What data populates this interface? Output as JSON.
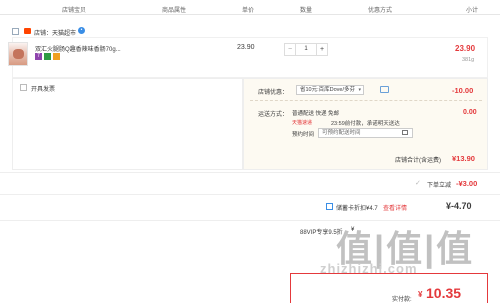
{
  "header": {
    "col_store": "店铺宝贝",
    "col_props": "商品属性",
    "col_price": "单价",
    "col_qty": "数量",
    "col_discount": "优惠方式",
    "col_subtotal": "小计"
  },
  "store": {
    "label": "店铺：天猫超市"
  },
  "item": {
    "title": "双汇火腿肠Q趣香辣味香肠70g...",
    "unit_price": "23.90",
    "qty": "1",
    "subtotal": "23.90",
    "weight": "381g",
    "tags": [
      {
        "name": "7",
        "color": "#8e44ad"
      },
      {
        "name": "绿",
        "color": "#2e9a43"
      },
      {
        "name": "黄",
        "color": "#f0a020"
      }
    ]
  },
  "extras": {
    "invoice_label": "开具发票",
    "coupon_label": "店铺优惠：",
    "coupon_value": "省10元:百库Dove/多芬",
    "coupon_amount": "-10.00",
    "delivery_label": "运送方式：",
    "delivery_mode": "普通配送 快递 免邮",
    "delivery_tag": "天猫速递",
    "delivery_note": "23:59前付款，承诺明天送达",
    "delivery_time_label": "预约时间",
    "delivery_time_placeholder": "可预约配送时间",
    "delivery_amount": "0.00"
  },
  "store_total": {
    "label": "店铺合计(含运费)",
    "value": "¥13.90"
  },
  "instant_discount": {
    "label": "下单立减",
    "value": "-¥3.00"
  },
  "card_discount": {
    "label": "储蓄卡折扣¥4.7",
    "link": "查看详情",
    "value": "¥-4.70"
  },
  "vip": {
    "label": "88VIP专享9.5折",
    "value": "¥"
  },
  "footer": {
    "paid_label": "实付款:",
    "paid_value": "¥10.35",
    "paid_symbol": "¥",
    "paid_amount": "10.35"
  },
  "watermark": {
    "text": "值|值|值",
    "url": "zhizhizhi.com"
  }
}
